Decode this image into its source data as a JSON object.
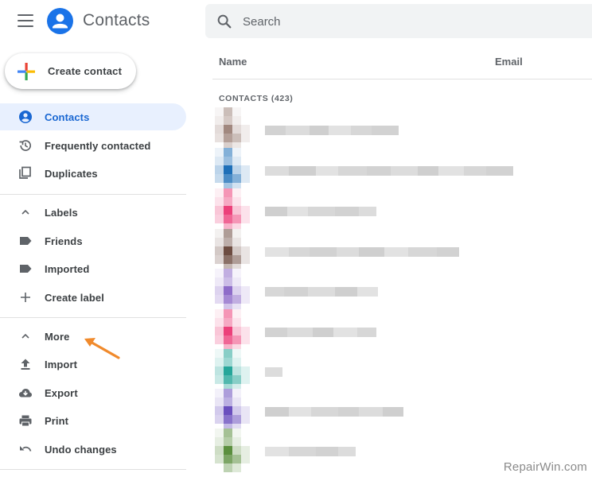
{
  "header": {
    "app_title": "Contacts",
    "search_placeholder": "Search",
    "icons": [
      "menu-icon",
      "contacts-logo-icon",
      "search-icon"
    ]
  },
  "create_button": {
    "label": "Create contact",
    "icon": "multicolor-plus-icon"
  },
  "sidebar": {
    "primary": [
      {
        "label": "Contacts",
        "icon": "person-icon",
        "active": true,
        "accent": "#1967d2"
      },
      {
        "label": "Frequently contacted",
        "icon": "history-icon"
      },
      {
        "label": "Duplicates",
        "icon": "copy-icon"
      }
    ],
    "labels_section": {
      "header": "Labels",
      "items": [
        {
          "label": "Friends",
          "icon": "label-icon"
        },
        {
          "label": "Imported",
          "icon": "label-icon"
        },
        {
          "label": "Create label",
          "icon": "plus-icon"
        }
      ]
    },
    "more_section": {
      "header": "More",
      "items": [
        {
          "label": "Import",
          "icon": "upload-icon"
        },
        {
          "label": "Export",
          "icon": "cloud-download-icon"
        },
        {
          "label": "Print",
          "icon": "printer-icon"
        },
        {
          "label": "Undo changes",
          "icon": "undo-icon"
        }
      ]
    }
  },
  "list": {
    "columns": [
      "Name",
      "Email"
    ],
    "section_label": "CONTACTS (423)",
    "rows": [
      {
        "avatar_color": "#a1887f"
      },
      {
        "avatar_color": "#1e6fb8"
      },
      {
        "avatar_color": "#ec407a"
      },
      {
        "avatar_color": "#6d4c41"
      },
      {
        "avatar_color": "#8e6cc9"
      },
      {
        "avatar_color": "#ec407a"
      },
      {
        "avatar_color": "#26a69a"
      },
      {
        "avatar_color": "#6a4fbe"
      },
      {
        "avatar_color": "#5b8f3e"
      }
    ]
  },
  "annotation": {
    "arrow_color": "#f08a2c"
  },
  "watermark": "RepairWin.com"
}
